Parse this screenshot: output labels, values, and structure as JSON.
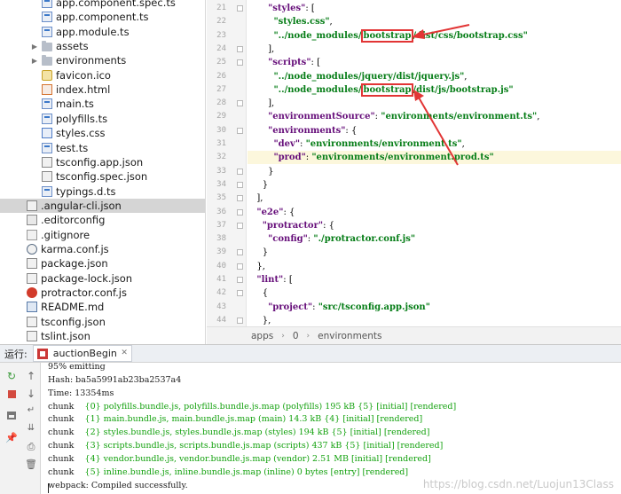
{
  "tree": {
    "items": [
      {
        "label": "app.component.spec.ts",
        "icon": "ts-file-icon",
        "kind": "ts"
      },
      {
        "label": "app.component.ts",
        "icon": "ts-file-icon",
        "kind": "ts"
      },
      {
        "label": "app.module.ts",
        "icon": "ts-file-icon",
        "kind": "ts"
      },
      {
        "label": "assets",
        "icon": "folder-icon",
        "kind": "folder"
      },
      {
        "label": "environments",
        "icon": "folder-icon",
        "kind": "folder"
      },
      {
        "label": "favicon.ico",
        "icon": "ico-file-icon",
        "kind": "ico"
      },
      {
        "label": "index.html",
        "icon": "html-file-icon",
        "kind": "html"
      },
      {
        "label": "main.ts",
        "icon": "ts-file-icon",
        "kind": "ts"
      },
      {
        "label": "polyfills.ts",
        "icon": "ts-file-icon",
        "kind": "ts"
      },
      {
        "label": "styles.css",
        "icon": "css-file-icon",
        "kind": "css"
      },
      {
        "label": "test.ts",
        "icon": "ts-file-icon",
        "kind": "ts"
      },
      {
        "label": "tsconfig.app.json",
        "icon": "json-file-icon",
        "kind": "json"
      },
      {
        "label": "tsconfig.spec.json",
        "icon": "json-file-icon",
        "kind": "json"
      },
      {
        "label": "typings.d.ts",
        "icon": "ts-file-icon",
        "kind": "ts"
      },
      {
        "label": ".angular-cli.json",
        "icon": "json-file-icon",
        "kind": "json"
      },
      {
        "label": ".editorconfig",
        "icon": "config-file-icon",
        "kind": "cfg"
      },
      {
        "label": ".gitignore",
        "icon": "git-file-icon",
        "kind": "git"
      },
      {
        "label": "karma.conf.js",
        "icon": "karma-file-icon",
        "kind": "karma"
      },
      {
        "label": "package.json",
        "icon": "json-file-icon",
        "kind": "json"
      },
      {
        "label": "package-lock.json",
        "icon": "json-file-icon",
        "kind": "json"
      },
      {
        "label": "protractor.conf.js",
        "icon": "protractor-file-icon",
        "kind": "prot"
      },
      {
        "label": "README.md",
        "icon": "markdown-file-icon",
        "kind": "md"
      },
      {
        "label": "tsconfig.json",
        "icon": "json-file-icon",
        "kind": "json"
      },
      {
        "label": "tslint.json",
        "icon": "json-file-icon",
        "kind": "json"
      }
    ]
  },
  "editor": {
    "line_numbers": [
      "21",
      "22",
      "23",
      "24",
      "25",
      "26",
      "27",
      "28",
      "29",
      "30",
      "31",
      "32",
      "33",
      "34",
      "35",
      "36",
      "37",
      "38",
      "39",
      "40",
      "41",
      "42",
      "43",
      "44"
    ],
    "lines": [
      [
        [
          "k",
          "\"styles\""
        ],
        [
          "p",
          ": ["
        ]
      ],
      [
        [
          "s",
          "\"styles.css\""
        ],
        [
          "p",
          ","
        ]
      ],
      [
        [
          "s",
          "\"../node_modules/"
        ],
        [
          "h",
          "bootstrap"
        ],
        [
          "s",
          "/dist/css/bootstrap.css\""
        ]
      ],
      [
        [
          "p",
          "],"
        ]
      ],
      [
        [
          "k",
          "\"scripts\""
        ],
        [
          "p",
          ": ["
        ]
      ],
      [
        [
          "s",
          "\"../node_modules/jquery/dist/jquery.js\""
        ],
        [
          "p",
          ","
        ]
      ],
      [
        [
          "s",
          "\"../node_modules/"
        ],
        [
          "h",
          "bootstrap"
        ],
        [
          "s",
          "/dist/js/bootstrap.js\""
        ]
      ],
      [
        [
          "p",
          "],"
        ]
      ],
      [
        [
          "k",
          "\"environmentSource\""
        ],
        [
          "p",
          ": "
        ],
        [
          "s",
          "\"environments/environment.ts\""
        ],
        [
          "p",
          ","
        ]
      ],
      [
        [
          "k",
          "\"environments\""
        ],
        [
          "p",
          ": {"
        ]
      ],
      [
        [
          "k",
          "\"dev\""
        ],
        [
          "p",
          ": "
        ],
        [
          "s",
          "\"environments/environment.ts\""
        ],
        [
          "p",
          ","
        ]
      ],
      [
        [
          "k",
          "\"prod\""
        ],
        [
          "p",
          ": "
        ],
        [
          "s",
          "\"environments/environment.prod.ts\""
        ]
      ],
      [
        [
          "p",
          "}"
        ]
      ],
      [
        [
          "p",
          "}"
        ]
      ],
      [
        [
          "p",
          "],"
        ]
      ],
      [
        [
          "k",
          "\"e2e\""
        ],
        [
          "p",
          ": {"
        ]
      ],
      [
        [
          "k",
          "\"protractor\""
        ],
        [
          "p",
          ": {"
        ]
      ],
      [
        [
          "k",
          "\"config\""
        ],
        [
          "p",
          ": "
        ],
        [
          "s",
          "\"./protractor.conf.js\""
        ]
      ],
      [
        [
          "p",
          "}"
        ]
      ],
      [
        [
          "p",
          "},"
        ]
      ],
      [
        [
          "k",
          "\"lint\""
        ],
        [
          "p",
          ": ["
        ]
      ],
      [
        [
          "p",
          "{"
        ]
      ],
      [
        [
          "k",
          "\"project\""
        ],
        [
          "p",
          ": "
        ],
        [
          "s",
          "\"src/tsconfig.app.json\""
        ]
      ],
      [
        [
          "p",
          "},"
        ]
      ]
    ]
  },
  "breadcrumbs": [
    "apps",
    "0",
    "environments"
  ],
  "run": {
    "title": "运行:",
    "tab_label": "auctionBegin",
    "console": [
      {
        "text": "95% emitting",
        "green": false
      },
      {
        "text": "Hash: ba5a5991ab23ba2537a4",
        "green": false
      },
      {
        "text": "Time: 13354ms",
        "green": false
      },
      {
        "prefix": "chunk",
        "text": "{0} polyfills.bundle.js, polyfills.bundle.js.map (polyfills) 195 kB {5} [initial] [rendered]",
        "green": true
      },
      {
        "prefix": "chunk",
        "text": "{1} main.bundle.js, main.bundle.js.map (main) 14.3 kB {4} [initial] [rendered]",
        "green": true
      },
      {
        "prefix": "chunk",
        "text": "{2} styles.bundle.js, styles.bundle.js.map (styles) 194 kB {5} [initial] [rendered]",
        "green": true
      },
      {
        "prefix": "chunk",
        "text": "{3} scripts.bundle.js, scripts.bundle.js.map (scripts) 437 kB {5} [initial] [rendered]",
        "green": true
      },
      {
        "prefix": "chunk",
        "text": "{4} vendor.bundle.js, vendor.bundle.js.map (vendor) 2.51 MB [initial] [rendered]",
        "green": true
      },
      {
        "prefix": "chunk",
        "text": "{5} inline.bundle.js, inline.bundle.js.map (inline) 0 bytes [entry] [rendered]",
        "green": true
      },
      {
        "text": "webpack: Compiled successfully.",
        "green": false
      }
    ],
    "watermark": "https://blog.csdn.net/Luojun13Class"
  },
  "colors": {
    "keyword": "#660e7a",
    "string": "#067d17",
    "annotation": "#e23535",
    "console_green": "#13a10e"
  }
}
